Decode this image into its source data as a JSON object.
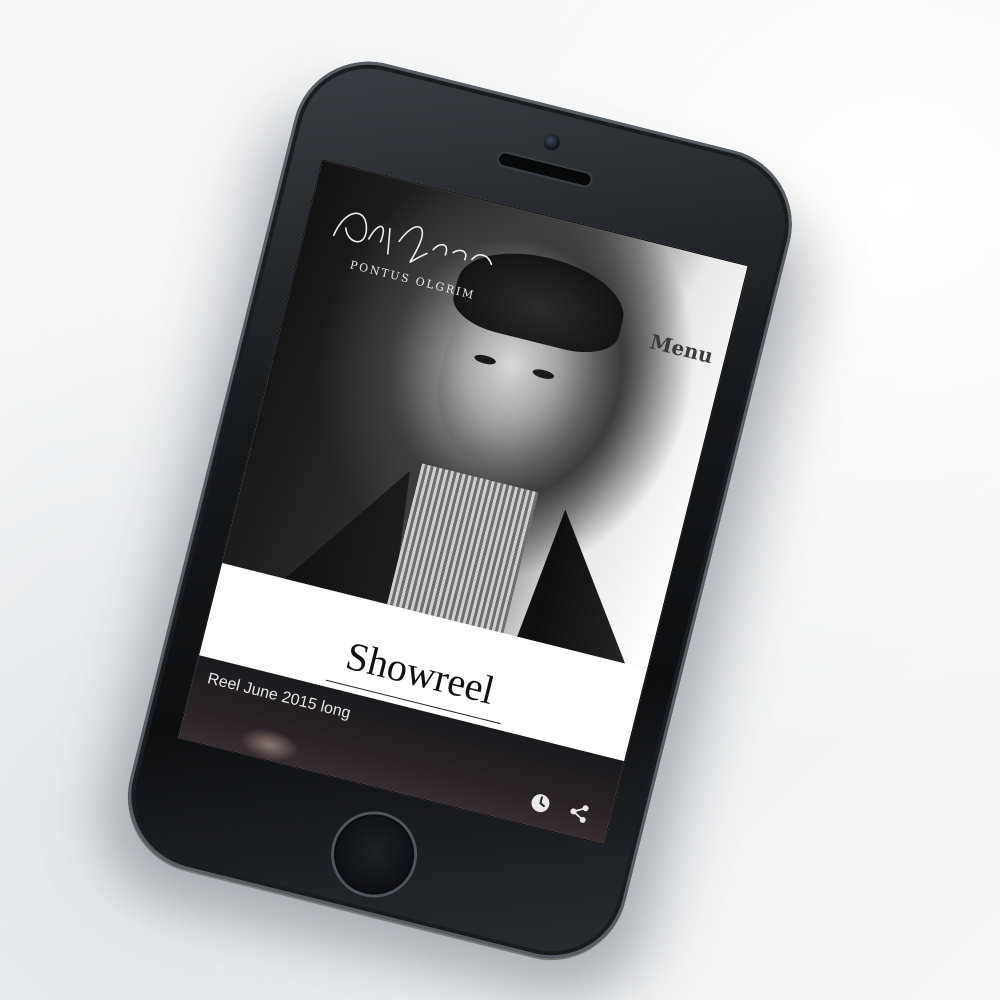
{
  "site": {
    "logo": {
      "signature_text": "Pontus Olgrim",
      "name": "PONTUS OLGRIM"
    },
    "menu_label": "Menu"
  },
  "main": {
    "section_title": "Showreel",
    "video": {
      "title": "Reel June 2015 long",
      "actions": {
        "watch_later_icon": "clock-icon",
        "share_icon": "share-icon"
      }
    }
  },
  "device": {
    "type": "smartphone",
    "color": "#15181b"
  }
}
